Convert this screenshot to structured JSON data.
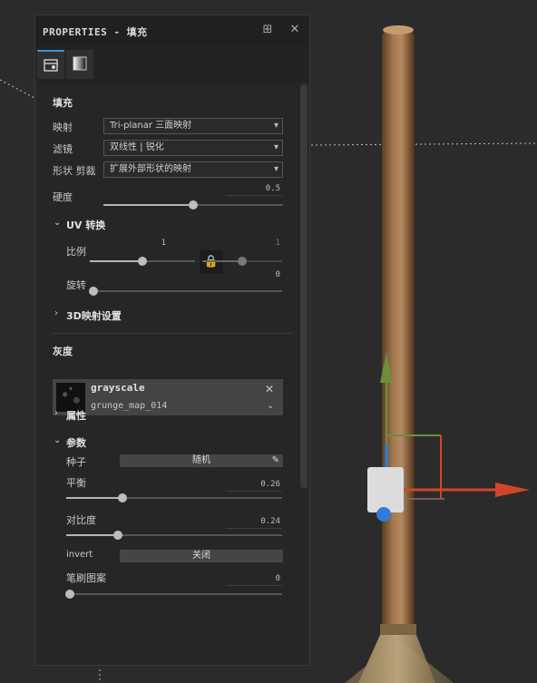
{
  "panel": {
    "title": "PROPERTIES - 填充",
    "dock_icon": "dock-icon",
    "close_icon": "close-icon",
    "tabs": [
      {
        "icon": "fill-properties-icon"
      },
      {
        "icon": "gradient-icon"
      }
    ]
  },
  "fill": {
    "section_label": "填充",
    "mapping_label": "映射",
    "mapping_value": "Tri-planar 三面映射",
    "filter_label": "滤镜",
    "filter_value": "双线性 | 锐化",
    "shape_crop_label": "形状 剪裁",
    "shape_crop_value": "扩展外部形状的映射",
    "hardness_label": "硬度",
    "hardness_value": "0.5",
    "hardness_level": 0.5
  },
  "uv": {
    "section_label": "UV 转换",
    "scale_label": "比例",
    "scale_value_1": "1",
    "scale_value_2": "1",
    "scale_level": 0.5,
    "rotation_label": "旋转",
    "rotation_value": "0",
    "rotation_level": 0.0
  },
  "mapping3d": {
    "section_label": "3D映射设置"
  },
  "grayscale": {
    "section_label": "灰度",
    "resource_name": "grayscale",
    "resource_sub": "grunge_map_014",
    "attributes_label": "属性",
    "params_label": "参数",
    "seed_label": "种子",
    "seed_value": "随机",
    "balance_label": "平衡",
    "balance_value": "0.26",
    "balance_level": 0.26,
    "contrast_label": "对比度",
    "contrast_value": "0.24",
    "contrast_level": 0.24,
    "invert_label": "invert",
    "invert_value": "关闭",
    "brush_label": "笔刷图案",
    "brush_value": "0",
    "brush_level": 0.0
  },
  "colors": {
    "accent": "#3d8fe0",
    "gizmo_x": "#d2452a",
    "gizmo_y": "#6e8f3a",
    "gizmo_z": "#2f7bd6"
  }
}
